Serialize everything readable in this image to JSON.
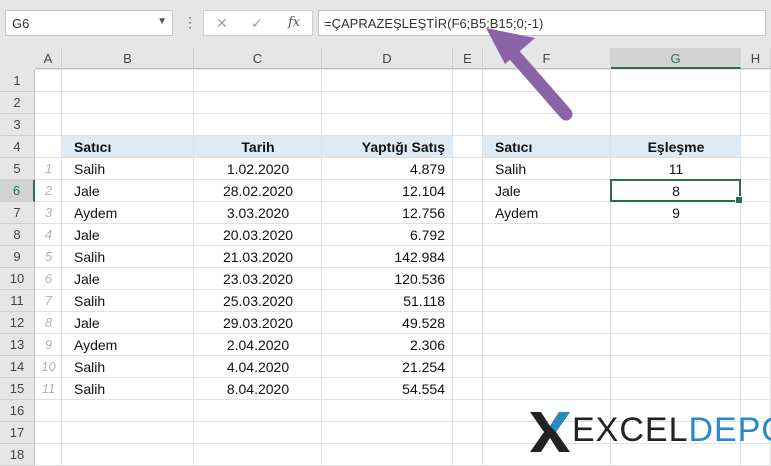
{
  "formula_bar": {
    "name_box": "G6",
    "formula": "=ÇAPRAZEŞLEŞTİR(F6;B5:B15;0;-1)",
    "icons": [
      "dots-icon",
      "cancel-icon",
      "confirm-icon",
      "fx-icon"
    ]
  },
  "columns": [
    "A",
    "B",
    "C",
    "D",
    "E",
    "F",
    "G",
    "H"
  ],
  "rows": [
    "1",
    "2",
    "3",
    "4",
    "5",
    "6",
    "7",
    "8",
    "9",
    "10",
    "11",
    "12",
    "13",
    "14",
    "15",
    "16",
    "17",
    "18"
  ],
  "selected": {
    "column": "G",
    "row": "6"
  },
  "table1": {
    "headers": [
      "Satıcı",
      "Tarih",
      "Yaptığı Satış"
    ],
    "rows": [
      {
        "idx": "1",
        "seller": "Salih",
        "date": "1.02.2020",
        "sales": "4.879"
      },
      {
        "idx": "2",
        "seller": "Jale",
        "date": "28.02.2020",
        "sales": "12.104"
      },
      {
        "idx": "3",
        "seller": "Aydem",
        "date": "3.03.2020",
        "sales": "12.756"
      },
      {
        "idx": "4",
        "seller": "Jale",
        "date": "20.03.2020",
        "sales": "6.792"
      },
      {
        "idx": "5",
        "seller": "Salih",
        "date": "21.03.2020",
        "sales": "142.984"
      },
      {
        "idx": "6",
        "seller": "Jale",
        "date": "23.03.2020",
        "sales": "120.536"
      },
      {
        "idx": "7",
        "seller": "Salih",
        "date": "25.03.2020",
        "sales": "51.118"
      },
      {
        "idx": "8",
        "seller": "Jale",
        "date": "29.03.2020",
        "sales": "49.528"
      },
      {
        "idx": "9",
        "seller": "Aydem",
        "date": "2.04.2020",
        "sales": "2.306"
      },
      {
        "idx": "10",
        "seller": "Salih",
        "date": "4.04.2020",
        "sales": "21.254"
      },
      {
        "idx": "11",
        "seller": "Salih",
        "date": "8.04.2020",
        "sales": "54.554"
      }
    ]
  },
  "table2": {
    "headers": [
      "Satıcı",
      "Eşleşme"
    ],
    "rows": [
      {
        "seller": "Salih",
        "match": "11"
      },
      {
        "seller": "Jale",
        "match": "8"
      },
      {
        "seller": "Aydem",
        "match": "9"
      }
    ]
  },
  "logo": {
    "part1": "EXCEL",
    "part2": "DEPO"
  },
  "colors": {
    "accent": "#217346",
    "header_fill": "#ddebf7",
    "logo_blue": "#2a8ac9",
    "arrow": "#8b63a8"
  }
}
